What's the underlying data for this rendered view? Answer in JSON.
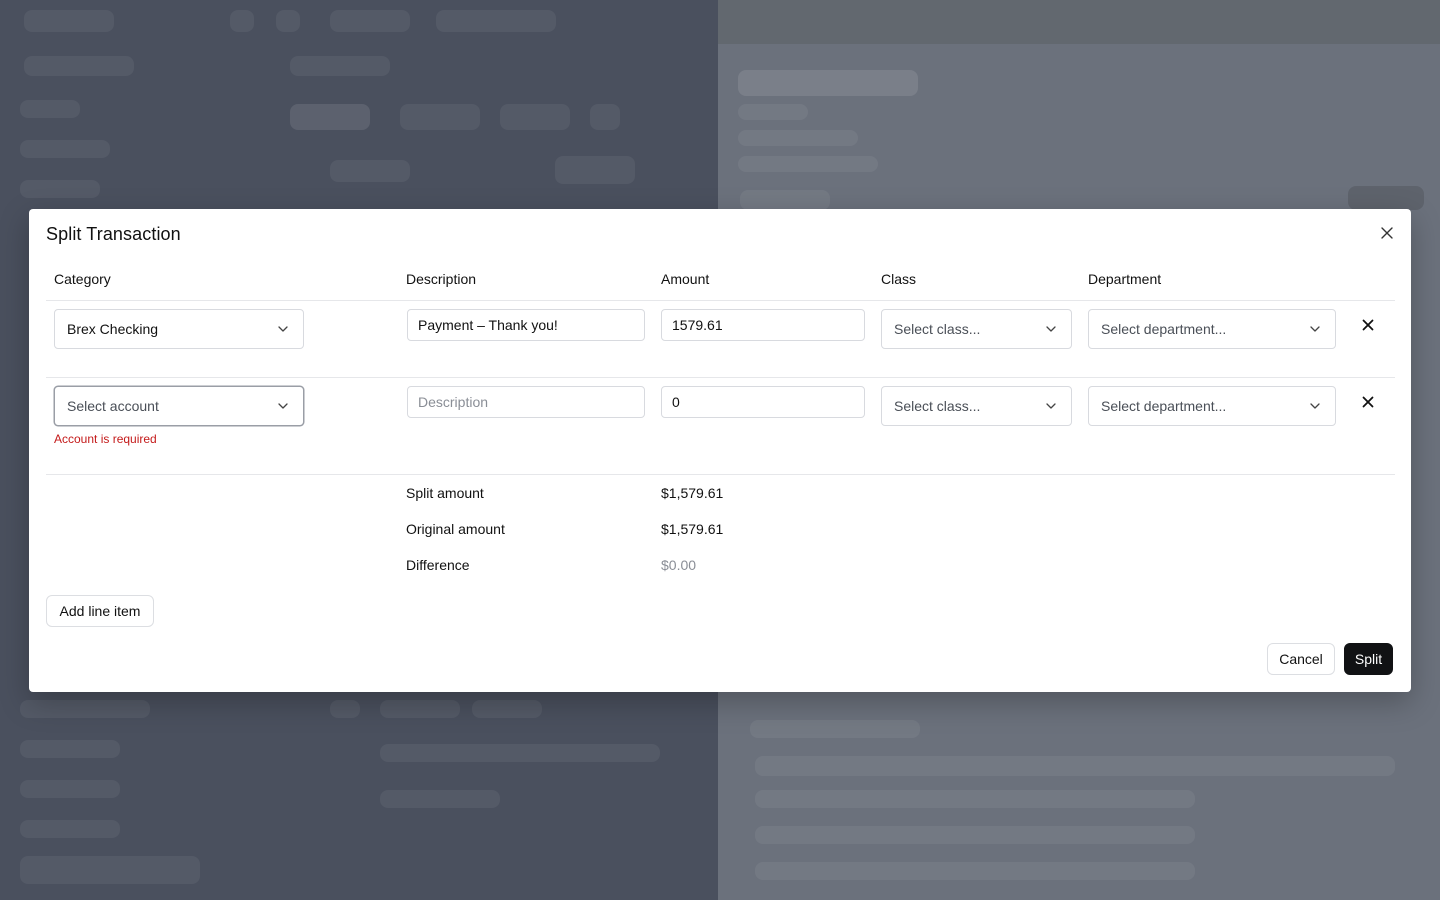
{
  "dialog": {
    "title": "Split Transaction",
    "close_icon": "close-icon"
  },
  "columns": {
    "category": "Category",
    "description": "Description",
    "amount": "Amount",
    "class": "Class",
    "department": "Department"
  },
  "rows": [
    {
      "category": "Brex Checking",
      "description": "Payment – Thank you!",
      "description_placeholder": "Description",
      "amount": "1579.61",
      "class": "Select class...",
      "department": "Select department..."
    },
    {
      "category": "Select account",
      "description": "",
      "description_placeholder": "Description",
      "amount": "0",
      "class": "Select class...",
      "department": "Select department...",
      "error": "Account is required"
    }
  ],
  "summary": {
    "split_label": "Split amount",
    "split_value": "$1,579.61",
    "original_label": "Original amount",
    "original_value": "$1,579.61",
    "difference_label": "Difference",
    "difference_value": "$0.00"
  },
  "actions": {
    "add_line": "Add line item",
    "cancel": "Cancel",
    "split": "Split"
  },
  "colors": {
    "error": "#c41a1a",
    "primary_button": "#111214",
    "overlay": "#4b5160"
  }
}
